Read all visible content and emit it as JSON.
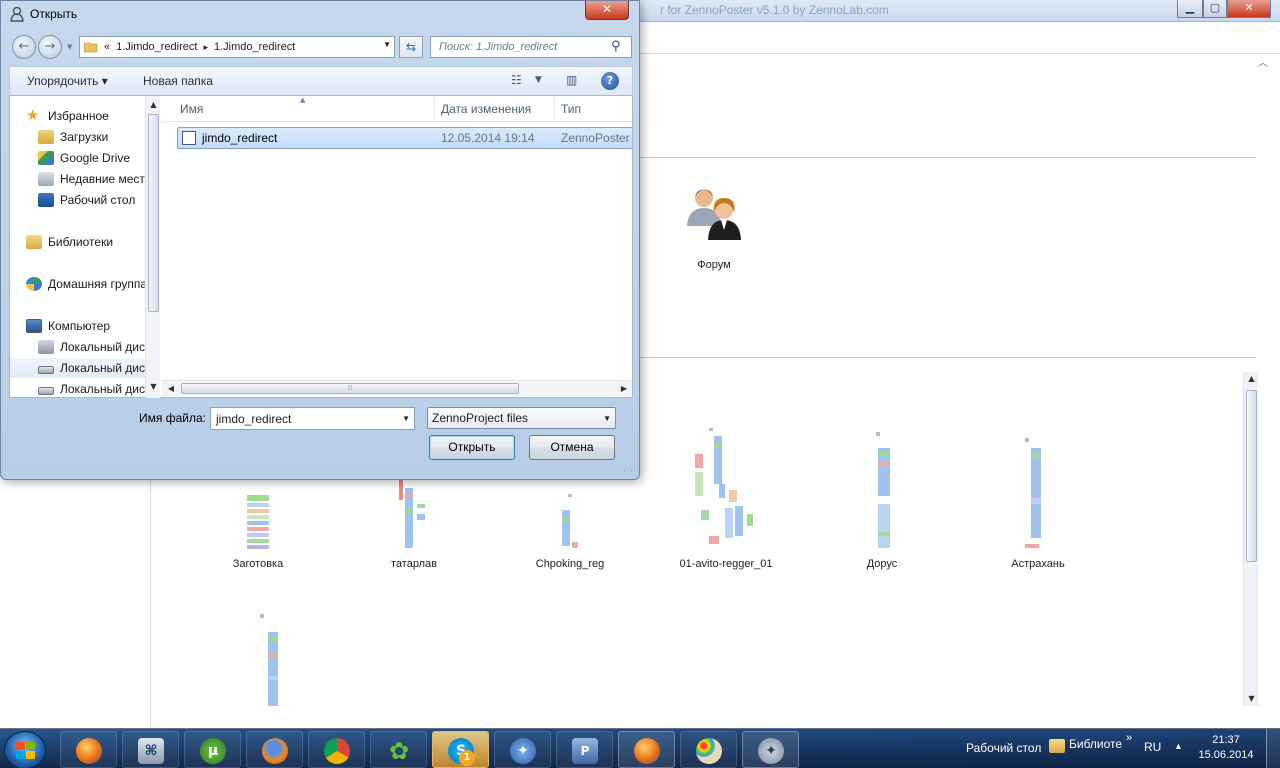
{
  "background_window": {
    "title": "r for ZennoPoster v5.1.0 by ZennoLab.com",
    "minimize": "▁",
    "maximize": "▢",
    "close": "✕",
    "forum_label": "Форум",
    "partial_label": "|",
    "projects": [
      {
        "label": "Заготовка"
      },
      {
        "label": "татарлав"
      },
      {
        "label": "Chpoking_reg"
      },
      {
        "label": "01-avito-regger_01"
      },
      {
        "label": "Дорус"
      },
      {
        "label": "Астрахань"
      },
      {
        "label": ""
      }
    ]
  },
  "dialog": {
    "title": "Открыть",
    "close": "✕",
    "address": {
      "prefix": "«",
      "crumbs": [
        "1.Jimdo_redirect",
        "1.Jimdo_redirect"
      ],
      "separator": "▸"
    },
    "search_placeholder": "Поиск: 1.Jimdo_redirect",
    "toolbar": {
      "organize": "Упорядочить ▾",
      "new_folder": "Новая папка",
      "help": "?"
    },
    "nav": [
      {
        "label": "Избранное",
        "icon": "star-icon"
      },
      {
        "label": "Загрузки",
        "icon": "downloads-folder-icon"
      },
      {
        "label": "Google Drive",
        "icon": "google-drive-icon"
      },
      {
        "label": "Недавние места",
        "icon": "recent-places-icon"
      },
      {
        "label": "Рабочий стол",
        "icon": "desktop-icon"
      },
      {
        "label": "Библиотеки",
        "icon": "libraries-icon"
      },
      {
        "label": "Домашняя группа",
        "icon": "homegroup-icon"
      },
      {
        "label": "Компьютер",
        "icon": "computer-icon"
      },
      {
        "label": "Локальный диск",
        "icon": "system-drive-icon"
      },
      {
        "label": "Локальный диск",
        "icon": "drive-icon"
      },
      {
        "label": "Локальный диск",
        "icon": "drive-icon"
      }
    ],
    "columns": {
      "name": "Имя",
      "date": "Дата изменения",
      "type": "Тип"
    },
    "files": [
      {
        "name": "jimdo_redirect",
        "date": "12.05.2014 19:14",
        "type": "ZennoPoster p"
      }
    ],
    "filename_label": "Имя файла:",
    "filename_value": "jimdo_redirect",
    "filetype_value": "ZennoProject files",
    "open_button": "Открыть",
    "cancel_button": "Отмена"
  },
  "taskbar": {
    "desktop_label": "Рабочий стол",
    "libraries_label": "Библиоте",
    "expand": "»",
    "language": "RU",
    "tray_arrow": "▲",
    "time": "21:37",
    "date": "15.06.2014",
    "skype_badge": "1"
  }
}
